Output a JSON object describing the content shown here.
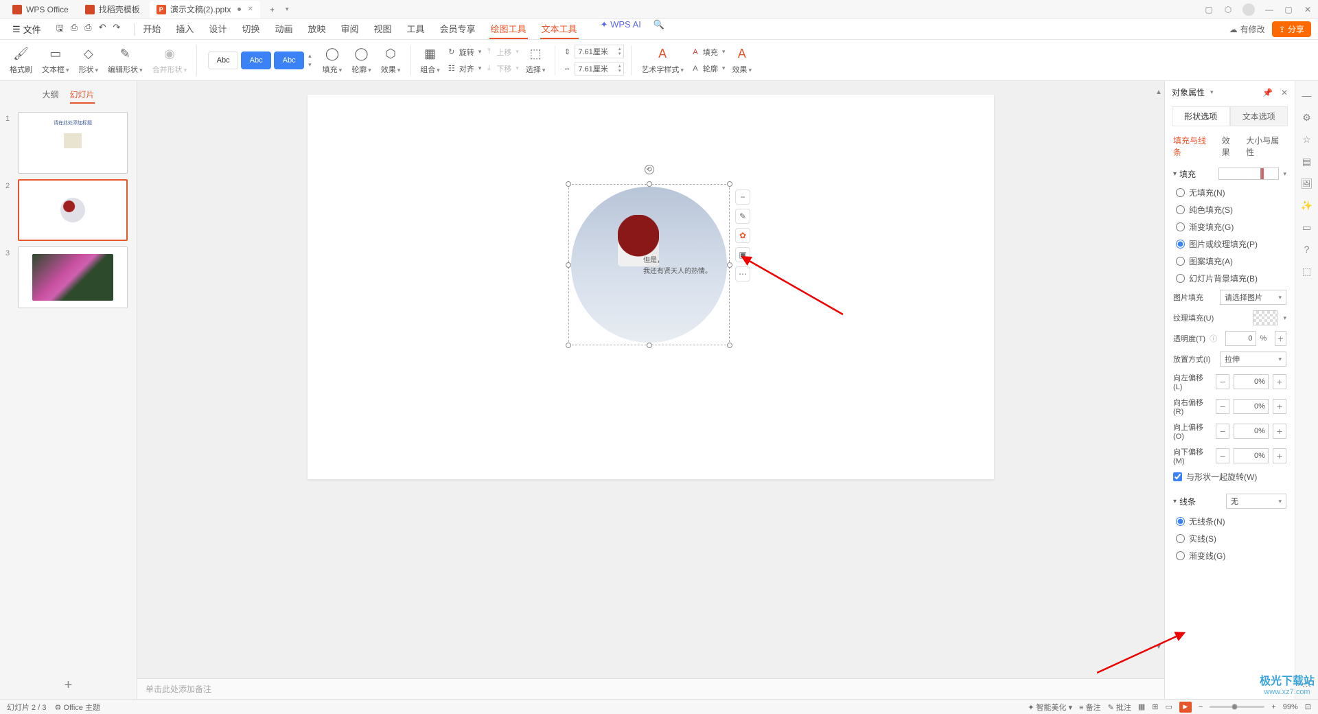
{
  "titlebar": {
    "tabs": [
      {
        "icon": "W",
        "label": "WPS Office"
      },
      {
        "icon": "D",
        "label": "找稻壳模板"
      },
      {
        "icon": "P",
        "label": "演示文稿(2).pptx",
        "active": true
      }
    ],
    "new_tab": "+"
  },
  "menubar": {
    "file": "文件",
    "tabs": [
      "开始",
      "插入",
      "设计",
      "切换",
      "动画",
      "放映",
      "审阅",
      "视图",
      "工具",
      "会员专享",
      "绘图工具",
      "文本工具"
    ],
    "active_tabs": [
      "绘图工具",
      "文本工具"
    ],
    "ai": "WPS AI",
    "modified": "有修改",
    "share": "分享"
  },
  "ribbon": {
    "format_painter": "格式刷",
    "textbox": "文本框",
    "shape": "形状",
    "edit_shape": "编辑形状",
    "merge_shape": "合并形状",
    "abc": "Abc",
    "fill": "填充",
    "outline": "轮廓",
    "effect": "效果",
    "group": "组合",
    "rotate": "旋转",
    "align": "对齐",
    "move_up": "上移",
    "move_down": "下移",
    "select": "选择",
    "width_val": "7.61厘米",
    "height_val": "7.61厘米",
    "art_style": "艺术字样式",
    "fill2": "填充",
    "outline2": "轮廓",
    "effect2": "效果"
  },
  "slide_panel": {
    "tab_outline": "大纲",
    "tab_slides": "幻灯片",
    "thumb1_title": "请在此处添加标题",
    "slides": [
      "1",
      "2",
      "3"
    ]
  },
  "canvas": {
    "txt1": "但是，",
    "txt2": "我还有贤天人的热情。",
    "notes_placeholder": "单击此处添加备注"
  },
  "prop": {
    "title": "对象属性",
    "tab_shape": "形状选项",
    "tab_text": "文本选项",
    "sub_fill": "填充与线条",
    "sub_effect": "效果",
    "sub_size": "大小与属性",
    "sec_fill": "填充",
    "fill_opts": {
      "none": "无填充(N)",
      "solid": "纯色填充(S)",
      "gradient": "渐变填充(G)",
      "picture": "图片或纹理填充(P)",
      "pattern": "图案填充(A)",
      "slidebg": "幻灯片背景填充(B)"
    },
    "pic_fill": "图片填充",
    "pic_sel": "请选择图片",
    "tex_fill": "纹理填充(U)",
    "opacity": "透明度(T)",
    "opacity_val": "0",
    "tile": "放置方式(I)",
    "tile_val": "拉伸",
    "off_left": "向左偏移(L)",
    "off_left_val": "0",
    "off_right": "向右偏移(R)",
    "off_right_val": "0",
    "off_top": "向上偏移(O)",
    "off_top_val": "0",
    "off_bottom": "向下偏移(M)",
    "off_bottom_val": "0",
    "pct": "%",
    "rotate_with": "与形状一起旋转(W)",
    "sec_line": "线条",
    "line_none": "无",
    "line_opts": {
      "none": "无线条(N)",
      "solid": "实线(S)",
      "gradient": "渐变线(G)"
    }
  },
  "status": {
    "slide_num": "幻灯片 2 / 3",
    "theme": "Office 主题",
    "smart": "智能美化",
    "notes": "备注",
    "comments": "批注",
    "zoom": "99%"
  },
  "watermark": {
    "name": "极光下载站",
    "url": "www.xz7.com"
  }
}
